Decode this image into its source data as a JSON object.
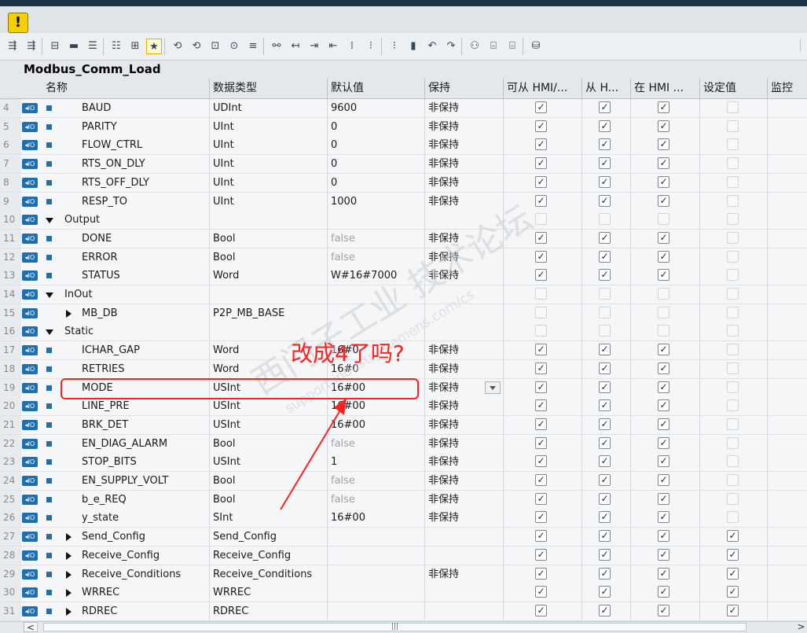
{
  "block_title": "Modbus_Comm_Load",
  "warning_icon_glyph": "!",
  "toolbar_icons": [
    "insert-row-icon",
    "add-row-icon",
    "expand-icon",
    "clear-icon",
    "align-left-icon",
    "align-center-icon",
    "indent-icon",
    "highlight-icon",
    "monitor-icon",
    "monitor-all-icon",
    "watch-icon",
    "force-icon",
    "table-icon",
    "filter-icon",
    "step-in-icon",
    "step-over-icon",
    "step-out-icon",
    "breakpoint-icon",
    "list-icon",
    "list2-icon",
    "columns-icon",
    "back-icon",
    "forward-icon",
    "network-icon",
    "compare-icon",
    "compare2-icon",
    "database-icon"
  ],
  "columns": {
    "name": "名称",
    "datatype": "数据类型",
    "default": "默认值",
    "retain": "保持",
    "hmi_access": "可从 HMI/...",
    "hmi_from": "从 H...",
    "hmi_in": "在 HMI ...",
    "setpoint": "设定值",
    "monitor": "监控"
  },
  "check_glyph": "✓",
  "rows": [
    {
      "num": "4",
      "indent": "1",
      "marker": "square",
      "name": "BAUD",
      "type": "UDInt",
      "default": "9600",
      "default_gray": false,
      "retain": "非保持",
      "c1": true,
      "c2": true,
      "c3": true,
      "c4": false,
      "dis": false
    },
    {
      "num": "5",
      "indent": "1",
      "marker": "square",
      "name": "PARITY",
      "type": "UInt",
      "default": "0",
      "default_gray": false,
      "retain": "非保持",
      "c1": true,
      "c2": true,
      "c3": true,
      "c4": false,
      "dis": false
    },
    {
      "num": "6",
      "indent": "1",
      "marker": "square",
      "name": "FLOW_CTRL",
      "type": "UInt",
      "default": "0",
      "default_gray": false,
      "retain": "非保持",
      "c1": true,
      "c2": true,
      "c3": true,
      "c4": false,
      "dis": false
    },
    {
      "num": "7",
      "indent": "1",
      "marker": "square",
      "name": "RTS_ON_DLY",
      "type": "UInt",
      "default": "0",
      "default_gray": false,
      "retain": "非保持",
      "c1": true,
      "c2": true,
      "c3": true,
      "c4": false,
      "dis": false
    },
    {
      "num": "8",
      "indent": "1",
      "marker": "square",
      "name": "RTS_OFF_DLY",
      "type": "UInt",
      "default": "0",
      "default_gray": false,
      "retain": "非保持",
      "c1": true,
      "c2": true,
      "c3": true,
      "c4": false,
      "dis": false
    },
    {
      "num": "9",
      "indent": "1",
      "marker": "square",
      "name": "RESP_TO",
      "type": "UInt",
      "default": "1000",
      "default_gray": false,
      "retain": "非保持",
      "c1": true,
      "c2": true,
      "c3": true,
      "c4": false,
      "dis": false
    },
    {
      "num": "10",
      "indent": "0",
      "marker": "down",
      "name": "Output",
      "type": "",
      "default": "",
      "default_gray": false,
      "retain": "",
      "c1": false,
      "c2": false,
      "c3": false,
      "c4": false,
      "dis": true
    },
    {
      "num": "11",
      "indent": "1",
      "marker": "square",
      "name": "DONE",
      "type": "Bool",
      "default": "false",
      "default_gray": true,
      "retain": "非保持",
      "c1": true,
      "c2": true,
      "c3": true,
      "c4": false,
      "dis": false
    },
    {
      "num": "12",
      "indent": "1",
      "marker": "square",
      "name": "ERROR",
      "type": "Bool",
      "default": "false",
      "default_gray": true,
      "retain": "非保持",
      "c1": true,
      "c2": true,
      "c3": true,
      "c4": false,
      "dis": false
    },
    {
      "num": "13",
      "indent": "1",
      "marker": "square",
      "name": "STATUS",
      "type": "Word",
      "default": "W#16#7000",
      "default_gray": false,
      "retain": "非保持",
      "c1": true,
      "c2": true,
      "c3": true,
      "c4": false,
      "dis": false
    },
    {
      "num": "14",
      "indent": "0",
      "marker": "down",
      "name": "InOut",
      "type": "",
      "default": "",
      "default_gray": false,
      "retain": "",
      "c1": false,
      "c2": false,
      "c3": false,
      "c4": false,
      "dis": true
    },
    {
      "num": "15",
      "indent": "0",
      "marker": "right",
      "name": "MB_DB",
      "type": "P2P_MB_BASE",
      "default": "",
      "default_gray": false,
      "retain": "",
      "c1": false,
      "c2": false,
      "c3": false,
      "c4": false,
      "dis": true
    },
    {
      "num": "16",
      "indent": "0",
      "marker": "down",
      "name": "Static",
      "type": "",
      "default": "",
      "default_gray": false,
      "retain": "",
      "c1": false,
      "c2": false,
      "c3": false,
      "c4": false,
      "dis": true
    },
    {
      "num": "17",
      "indent": "1",
      "marker": "square",
      "name": "ICHAR_GAP",
      "type": "Word",
      "default": "16#0",
      "default_gray": false,
      "retain": "非保持",
      "c1": true,
      "c2": true,
      "c3": true,
      "c4": false,
      "dis": false
    },
    {
      "num": "18",
      "indent": "1",
      "marker": "square",
      "name": "RETRIES",
      "type": "Word",
      "default": "16#0",
      "default_gray": false,
      "retain": "非保持",
      "c1": true,
      "c2": true,
      "c3": true,
      "c4": false,
      "dis": false
    },
    {
      "num": "19",
      "indent": "1",
      "marker": "square",
      "name": "MODE",
      "type": "USInt",
      "default": "16#00",
      "default_gray": false,
      "retain": "非保持",
      "c1": true,
      "c2": true,
      "c3": true,
      "c4": false,
      "dis": false,
      "dropdown": true
    },
    {
      "num": "20",
      "indent": "1",
      "marker": "square",
      "name": "LINE_PRE",
      "type": "USInt",
      "default": "16#00",
      "default_gray": false,
      "retain": "非保持",
      "c1": true,
      "c2": true,
      "c3": true,
      "c4": false,
      "dis": false
    },
    {
      "num": "21",
      "indent": "1",
      "marker": "square",
      "name": "BRK_DET",
      "type": "USInt",
      "default": "16#00",
      "default_gray": false,
      "retain": "非保持",
      "c1": true,
      "c2": true,
      "c3": true,
      "c4": false,
      "dis": false
    },
    {
      "num": "22",
      "indent": "1",
      "marker": "square",
      "name": "EN_DIAG_ALARM",
      "type": "Bool",
      "default": "false",
      "default_gray": true,
      "retain": "非保持",
      "c1": true,
      "c2": true,
      "c3": true,
      "c4": false,
      "dis": false
    },
    {
      "num": "23",
      "indent": "1",
      "marker": "square",
      "name": "STOP_BITS",
      "type": "USInt",
      "default": "1",
      "default_gray": false,
      "retain": "非保持",
      "c1": true,
      "c2": true,
      "c3": true,
      "c4": false,
      "dis": false
    },
    {
      "num": "24",
      "indent": "1",
      "marker": "square",
      "name": "EN_SUPPLY_VOLT",
      "type": "Bool",
      "default": "false",
      "default_gray": true,
      "retain": "非保持",
      "c1": true,
      "c2": true,
      "c3": true,
      "c4": false,
      "dis": false
    },
    {
      "num": "25",
      "indent": "1",
      "marker": "square",
      "name": "b_e_REQ",
      "type": "Bool",
      "default": "false",
      "default_gray": true,
      "retain": "非保持",
      "c1": true,
      "c2": true,
      "c3": true,
      "c4": false,
      "dis": false
    },
    {
      "num": "26",
      "indent": "1",
      "marker": "square",
      "name": "y_state",
      "type": "SInt",
      "default": "16#00",
      "default_gray": false,
      "retain": "非保持",
      "c1": true,
      "c2": true,
      "c3": true,
      "c4": false,
      "dis": false
    },
    {
      "num": "27",
      "indent": "1",
      "marker": "square-right",
      "name": "Send_Config",
      "type": "Send_Config",
      "default": "",
      "default_gray": false,
      "retain": "",
      "c1": true,
      "c2": true,
      "c3": true,
      "c4": true,
      "dis": false
    },
    {
      "num": "28",
      "indent": "1",
      "marker": "square-right",
      "name": "Receive_Config",
      "type": "Receive_Config",
      "default": "",
      "default_gray": false,
      "retain": "",
      "c1": true,
      "c2": true,
      "c3": true,
      "c4": true,
      "dis": false
    },
    {
      "num": "29",
      "indent": "1",
      "marker": "square-right",
      "name": "Receive_Conditions",
      "type": "Receive_Conditions",
      "default": "",
      "default_gray": false,
      "retain": "非保持",
      "c1": true,
      "c2": true,
      "c3": true,
      "c4": true,
      "dis": false
    },
    {
      "num": "30",
      "indent": "1",
      "marker": "square-right",
      "name": "WRREC",
      "type": "WRREC",
      "default": "",
      "default_gray": false,
      "retain": "",
      "c1": true,
      "c2": true,
      "c3": true,
      "c4": true,
      "dis": false
    },
    {
      "num": "31",
      "indent": "1",
      "marker": "square-right",
      "name": "RDREC",
      "type": "RDREC",
      "default": "",
      "default_gray": false,
      "retain": "",
      "c1": true,
      "c2": true,
      "c3": true,
      "c4": true,
      "dis": false
    }
  ],
  "io_badge": "◂IO",
  "annotation": {
    "text": "改成4了吗?",
    "color": "#ff2020"
  },
  "watermark": {
    "line1": "西门子工业 技术论坛",
    "line2": "support.industry.siemens.com/cs"
  },
  "scrollbar": {
    "left_arrow": "<",
    "grip": "|||",
    "right_arrow": ">"
  },
  "colors": {
    "accent": "#1d6fb0",
    "warning": "#f5d000",
    "annotation": "#ff2020"
  }
}
